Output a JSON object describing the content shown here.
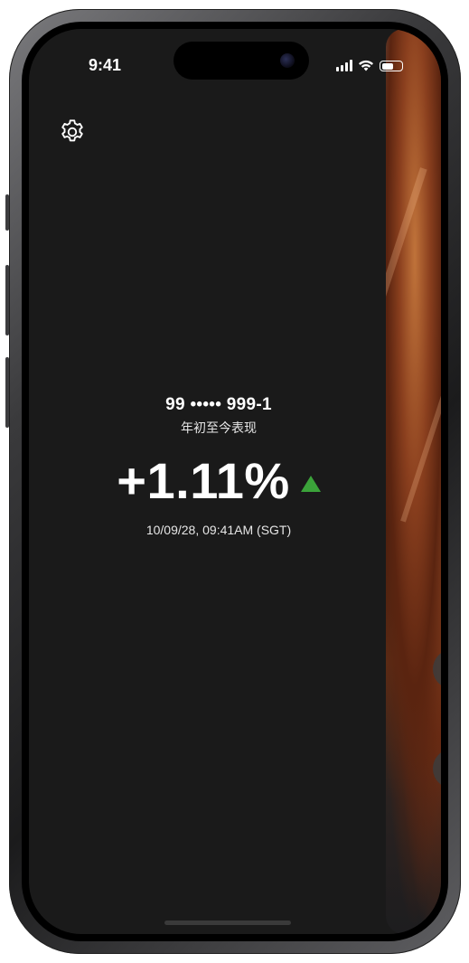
{
  "status_bar": {
    "time": "9:41",
    "signal_icon": "signal-icon",
    "wifi_icon": "wifi-icon",
    "battery_icon": "battery-icon"
  },
  "header": {
    "settings_icon": "gear-icon"
  },
  "account": {
    "number": "99 ••••• 999-1",
    "label": "年初至今表现"
  },
  "performance": {
    "value": "+1.11%",
    "trend_icon": "up-triangle-icon",
    "trend_color": "#3ba33a",
    "timestamp": "10/09/28, 09:41AM (SGT)"
  },
  "colors": {
    "background": "#1a1a1a",
    "text": "#ffffff"
  }
}
